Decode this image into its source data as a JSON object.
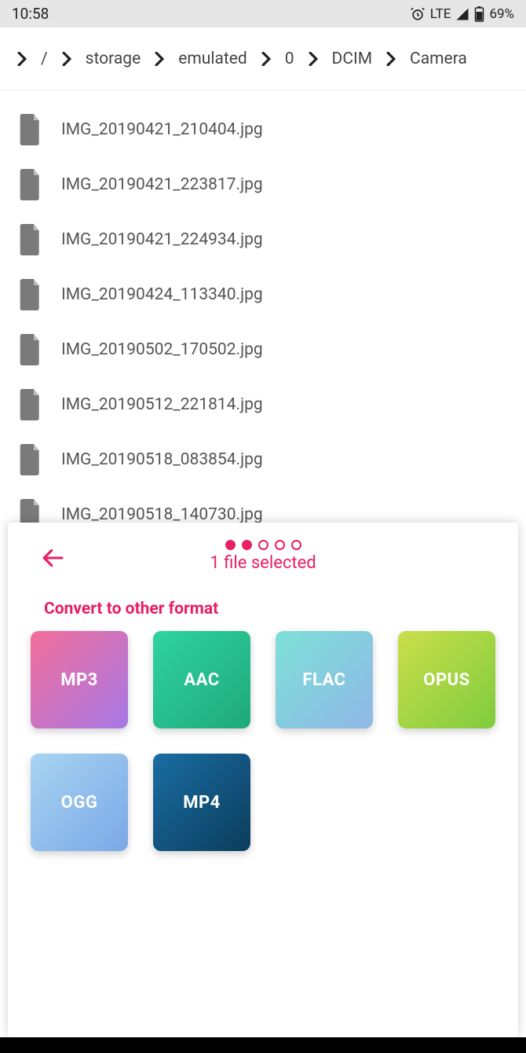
{
  "status": {
    "time": "10:58",
    "network": "LTE",
    "battery": "69%"
  },
  "breadcrumb": {
    "root": "/",
    "items": [
      "storage",
      "emulated",
      "0",
      "DCIM",
      "Camera"
    ]
  },
  "files": [
    "IMG_20190421_210404.jpg",
    "IMG_20190421_223817.jpg",
    "IMG_20190421_224934.jpg",
    "IMG_20190424_113340.jpg",
    "IMG_20190502_170502.jpg",
    "IMG_20190512_221814.jpg",
    "IMG_20190518_083854.jpg",
    "IMG_20190518_140730.jpg"
  ],
  "sheet": {
    "subtitle": "1 file selected",
    "section_title": "Convert to other format",
    "progress": {
      "current": 2,
      "total": 5
    },
    "formats": [
      "MP3",
      "AAC",
      "FLAC",
      "OPUS",
      "OGG",
      "MP4"
    ]
  },
  "colors": {
    "accent": "#e91e63"
  }
}
